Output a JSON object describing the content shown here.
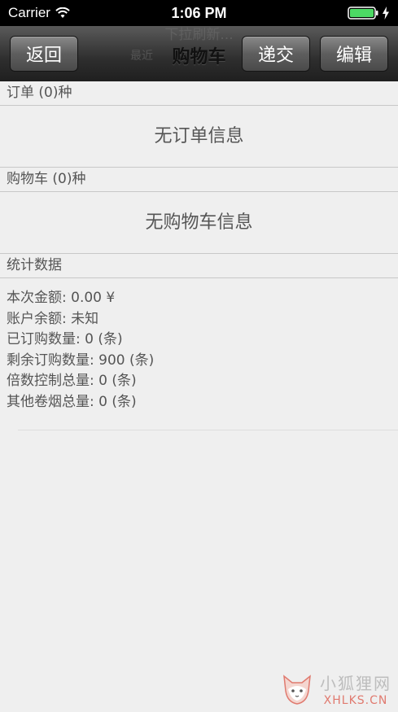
{
  "status_bar": {
    "carrier": "Carrier",
    "time": "1:06 PM"
  },
  "nav": {
    "back_label": "返回",
    "title": "购物车",
    "submit_label": "递交",
    "edit_label": "编辑",
    "pull_refresh": "下拉刷新...",
    "last_updated": "最近"
  },
  "orders": {
    "header": "订单 (0)种",
    "empty": "无订单信息"
  },
  "cart": {
    "header": "购物车 (0)种",
    "empty": "无购物车信息"
  },
  "stats": {
    "header": "统计数据",
    "lines": [
      "本次金额: 0.00 ¥",
      "账户余额: 未知",
      "已订购数量: 0 (条)",
      "剩余订购数量: 900 (条)",
      "倍数控制总量: 0 (条)",
      "其他卷烟总量: 0 (条)"
    ]
  },
  "watermark": {
    "cn": "小狐狸网",
    "en": "XHLKS.CN"
  },
  "colors": {
    "battery": "#4cd964",
    "nav_dark": "#1f1f1f",
    "background": "#efefef"
  }
}
